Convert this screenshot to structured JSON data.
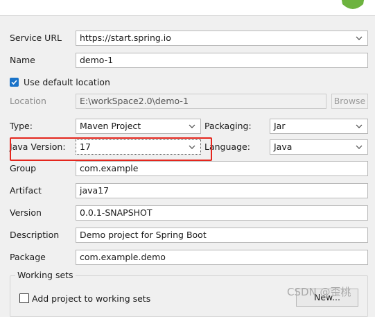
{
  "form": {
    "service_url": {
      "label": "Service URL",
      "value": "https://start.spring.io"
    },
    "name": {
      "label": "Name",
      "value": "demo-1"
    },
    "use_default_location": {
      "label": "Use default location",
      "checked": true
    },
    "location": {
      "label": "Location",
      "value": "E:\\workSpace2.0\\demo-1",
      "browse_label": "Browse"
    },
    "type": {
      "label": "Type:",
      "value": "Maven Project"
    },
    "packaging": {
      "label": "Packaging:",
      "value": "Jar"
    },
    "java_version": {
      "label": "Java Version:",
      "value": "17"
    },
    "language": {
      "label": "Language:",
      "value": "Java"
    },
    "group": {
      "label": "Group",
      "value": "com.example"
    },
    "artifact": {
      "label": "Artifact",
      "value": "java17"
    },
    "version": {
      "label": "Version",
      "value": "0.0.1-SNAPSHOT"
    },
    "description": {
      "label": "Description",
      "value": "Demo project for Spring Boot"
    },
    "package": {
      "label": "Package",
      "value": "com.example.demo"
    }
  },
  "working_sets": {
    "title": "Working sets",
    "add_label": "Add project to working sets",
    "new_button": "New..."
  },
  "watermark": "CSDN @歪桃",
  "colors": {
    "highlight": "#e4261d",
    "checkbox": "#1a73c9",
    "logo": "#6db33f"
  }
}
